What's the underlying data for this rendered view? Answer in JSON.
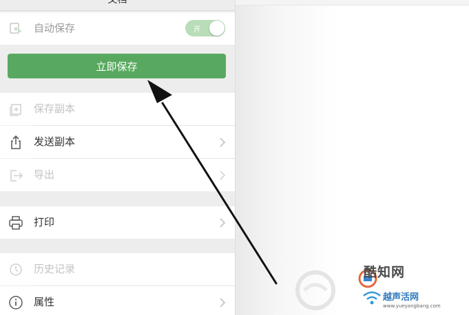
{
  "panel": {
    "title": "文档",
    "autosave": {
      "label": "自动保存",
      "toggle_text": "开",
      "enabled": true
    },
    "save_now_button": "立即保存",
    "items": [
      {
        "label": "保存副本",
        "icon": "add-copy-icon",
        "disabled": true,
        "chevron": false
      },
      {
        "label": "发送副本",
        "icon": "share-icon",
        "disabled": false,
        "chevron": true
      },
      {
        "label": "导出",
        "icon": "export-icon",
        "disabled": true,
        "chevron": true
      }
    ],
    "print": {
      "label": "打印",
      "icon": "printer-icon"
    },
    "history": {
      "label": "历史记录",
      "icon": "history-icon",
      "disabled": true
    },
    "properties": {
      "label": "属性",
      "icon": "info-icon"
    }
  },
  "watermark": {
    "brand_cn": "酷知网",
    "brand2_cn": "越声活网",
    "url": "www.yueyangbang.com"
  },
  "colors": {
    "accent_green": "#58a95f",
    "toggle_green": "#b9ddb9",
    "disabled_text": "#c3c3c3"
  }
}
